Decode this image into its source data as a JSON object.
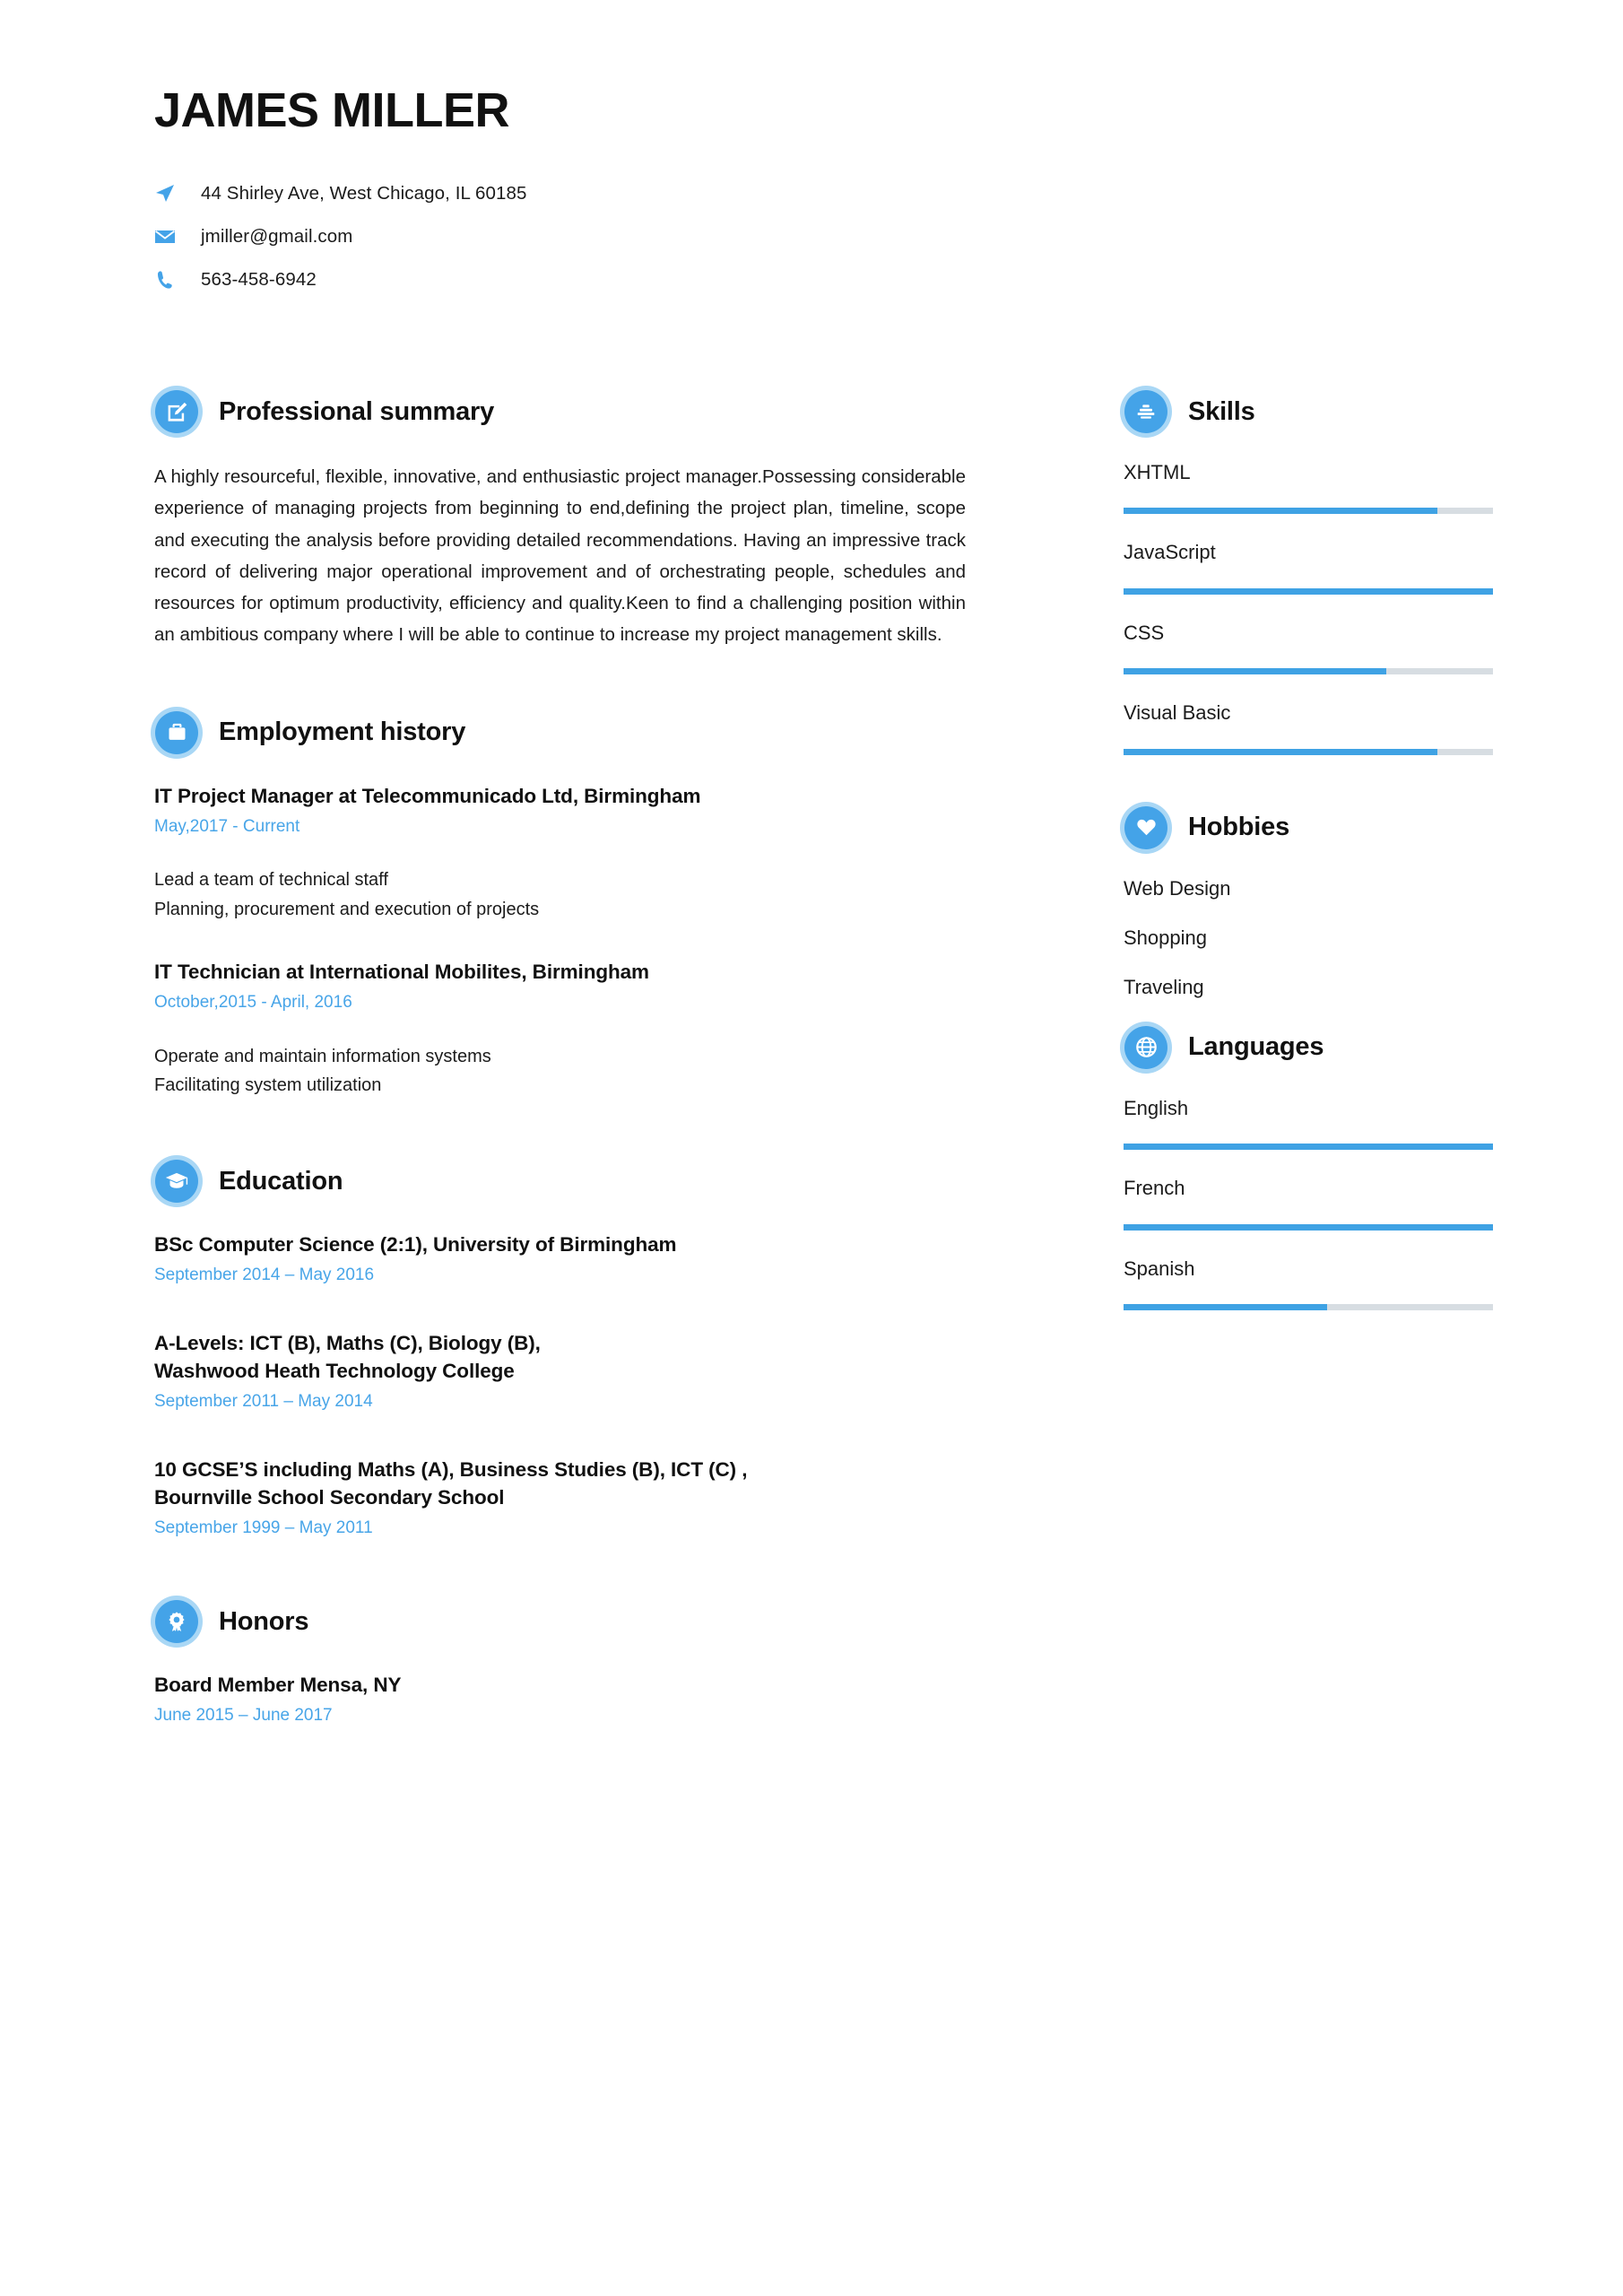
{
  "theme": {
    "accent": "#44a3e8",
    "accent_light": "#a9d7f5",
    "bar_fill": "#3fa2e4",
    "bar_track": "#d7dde2",
    "date_text": "#48a5e8",
    "body_text": "#1b1b1b",
    "background": "#ffffff"
  },
  "header": {
    "name": "JAMES MILLER",
    "contacts": [
      {
        "icon": "location-arrow-icon",
        "value": "44 Shirley Ave, West Chicago, IL 60185"
      },
      {
        "icon": "envelope-icon",
        "value": "jmiller@gmail.com"
      },
      {
        "icon": "phone-icon",
        "value": "563-458-6942"
      }
    ]
  },
  "sections": {
    "summary": {
      "title": "Professional summary",
      "icon": "edit-square-icon",
      "text": "A highly resourceful, flexible, innovative, and enthusiastic project manager.Possessing considerable experience of managing projects from beginning to end,defining the project plan, timeline, scope and executing the analysis before providing detailed recommendations. Having an impressive track record of delivering major operational improvement and of orchestrating people, schedules and resources for optimum productivity, efficiency and quality.Keen to find a challenging position within an ambitious company where I will be able to continue to increase my project management skills."
    },
    "employment": {
      "title": "Employment history",
      "icon": "briefcase-icon",
      "entries": [
        {
          "title": "IT Project Manager at Telecommunicado Ltd, Birmingham",
          "date": "May,2017 - Current",
          "bullets": [
            "Lead a team of technical staff",
            "Planning, procurement and execution of projects"
          ]
        },
        {
          "title": "IT Technician at International Mobilites, Birmingham",
          "date": "October,2015 - April, 2016",
          "bullets": [
            "Operate and maintain information systems",
            "Facilitating system utilization"
          ]
        }
      ]
    },
    "education": {
      "title": "Education",
      "icon": "graduation-cap-icon",
      "entries": [
        {
          "title": "BSc Computer Science (2:1), University of Birmingham",
          "date": "September 2014 – May 2016"
        },
        {
          "title": "A-Levels: ICT (B), Maths (C), Biology (B),\nWashwood Heath Technology College",
          "date": "September 2011 – May 2014"
        },
        {
          "title": "10 GCSE’S including Maths (A), Business Studies (B), ICT (C) ,\nBournville School Secondary School",
          "date": "September 1999 – May 2011"
        }
      ]
    },
    "honors": {
      "title": "Honors",
      "icon": "award-ribbon-icon",
      "entries": [
        {
          "title": "Board Member Mensa, NY",
          "date": "June 2015 – June 2017"
        }
      ]
    },
    "skills": {
      "title": "Skills",
      "icon": "stack-bars-icon",
      "items": [
        {
          "label": "XHTML",
          "level": 85
        },
        {
          "label": "JavaScript",
          "level": 100
        },
        {
          "label": "CSS",
          "level": 71
        },
        {
          "label": "Visual Basic",
          "level": 85
        }
      ]
    },
    "hobbies": {
      "title": "Hobbies",
      "icon": "heart-icon",
      "items": [
        {
          "label": "Web Design"
        },
        {
          "label": "Shopping"
        },
        {
          "label": "Traveling"
        }
      ]
    },
    "languages": {
      "title": "Languages",
      "icon": "globe-icon",
      "items": [
        {
          "label": "English",
          "level": 100
        },
        {
          "label": "French",
          "level": 100
        },
        {
          "label": "Spanish",
          "level": 55
        }
      ]
    }
  }
}
